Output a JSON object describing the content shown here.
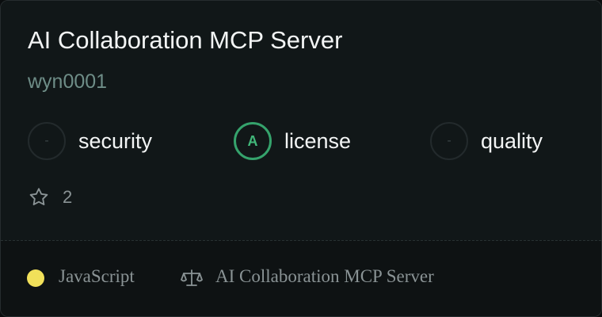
{
  "server": {
    "title": "AI Collaboration MCP Server",
    "author": "wyn0001"
  },
  "scores": [
    {
      "grade": "-",
      "label": "security",
      "status": "none"
    },
    {
      "grade": "A",
      "label": "license",
      "status": "good"
    },
    {
      "grade": "-",
      "label": "quality",
      "status": "none"
    }
  ],
  "stats": {
    "stars": "2",
    "star_icon": "star-outline-icon"
  },
  "footer": {
    "language": "JavaScript",
    "language_color": "#f1e05a",
    "license_icon": "scale-balance-icon",
    "license_name": "AI Collaboration MCP Server"
  },
  "colors": {
    "grade_good": "#35a36c"
  }
}
